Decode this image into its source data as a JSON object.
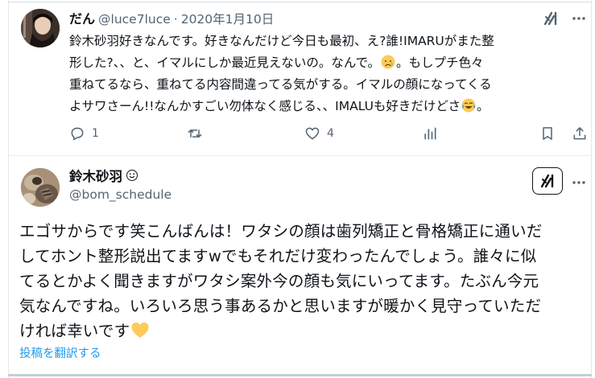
{
  "reply_tweet": {
    "display_name": "だん",
    "handle": "@luce7luce",
    "separator": "·",
    "date": "2020年1月10日",
    "more_icon": "more-dots",
    "grok_icon": "grok-logo",
    "body_lines": [
      "鈴木砂羽好きなんです。好きなんだけど今日も最初、え?誰!IMARUがまた整",
      "形した?、、と、イマルにしか最近見えないの。なんで。",
      "。もしプチ色々",
      "重ねてるなら、重ねてる内容間違ってる気がする。イマルの顔になってくる",
      "よサワさーん!!なんかすごい勿体なく感じる、、IMALUも好きだけどさ",
      "。"
    ],
    "emojis": [
      "sad-but-relieved-face",
      "face-with-tears-of-joy"
    ],
    "actions": {
      "reply_count": "1",
      "retweet_count": "",
      "like_count": "4"
    }
  },
  "main_tweet": {
    "display_name": "鈴木砂羽",
    "name_badge": "smiley-face",
    "handle": "@bom_schedule",
    "more_icon": "more-dots",
    "grok_icon": "grok-logo",
    "body_lines": [
      "エゴサからです笑こんばんは！ワタシの顔は歯列矯正と骨格矯正に通いだ",
      "してホント整形説出てますwでもそれだけ変わったんでしょう。誰々に似",
      "てるとかよく聞きますがワタシ案外今の顔も気にいってます。たぶん今元",
      "気なんですね。いろいろ思う事あるかと思いますが暖かく見守っていただ",
      "ければ幸いです"
    ],
    "end_emoji": "yellow-heart",
    "translate_link": "投稿を翻訳する"
  },
  "colors": {
    "text": "#0f1419",
    "secondary": "#536471",
    "link": "#1d9bf0",
    "divider": "#e7ecef",
    "heart_yellow": "#fdcb58"
  }
}
